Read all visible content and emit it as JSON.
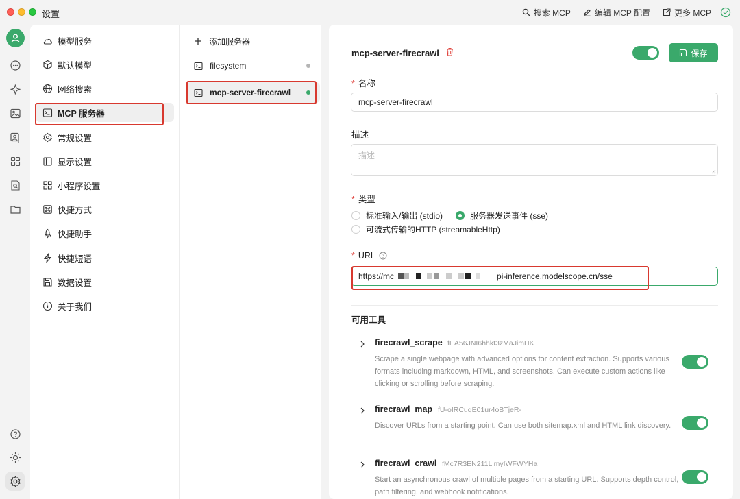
{
  "window": {
    "title": "设置"
  },
  "toolbar": {
    "search_mcp": "搜索 MCP",
    "edit_mcp_config": "编辑 MCP 配置",
    "more_mcp": "更多 MCP"
  },
  "sidebar": {
    "items": [
      {
        "label": "模型服务",
        "icon": "cloud-icon"
      },
      {
        "label": "默认模型",
        "icon": "cube-icon"
      },
      {
        "label": "网络搜索",
        "icon": "globe-icon"
      },
      {
        "label": "MCP 服务器",
        "icon": "terminal-icon"
      },
      {
        "label": "常规设置",
        "icon": "gear-icon"
      },
      {
        "label": "显示设置",
        "icon": "layout-icon"
      },
      {
        "label": "小程序设置",
        "icon": "grid-icon"
      },
      {
        "label": "快捷方式",
        "icon": "command-icon"
      },
      {
        "label": "快捷助手",
        "icon": "rocket-icon"
      },
      {
        "label": "快捷短语",
        "icon": "zap-icon"
      },
      {
        "label": "数据设置",
        "icon": "save-icon"
      },
      {
        "label": "关于我们",
        "icon": "info-icon"
      }
    ]
  },
  "servers": {
    "add_label": "添加服务器",
    "items": [
      {
        "name": "filesystem",
        "status_color": "#b5b5b5"
      },
      {
        "name": "mcp-server-firecrawl",
        "status_color": "#3aa96b"
      }
    ]
  },
  "detail": {
    "title": "mcp-server-firecrawl",
    "save_label": "保存",
    "name_label": "名称",
    "name_value": "mcp-server-firecrawl",
    "desc_label": "描述",
    "desc_placeholder": "描述",
    "type_label": "类型",
    "type_options": [
      "标准输入/输出 (stdio)",
      "服务器发送事件 (sse)",
      "可流式传输的HTTP (streamableHttp)"
    ],
    "type_selected": "服务器发送事件 (sse)",
    "url_label": "URL",
    "url_prefix": "https://mc",
    "url_suffix": "pi-inference.modelscope.cn/sse",
    "tools_title": "可用工具",
    "tools": [
      {
        "name": "firecrawl_scrape",
        "id": "fEA56JNI6hhkt3zMaJimHK",
        "desc": "Scrape a single webpage with advanced options for content extraction. Supports various formats including markdown, HTML, and screenshots. Can execute custom actions like clicking or scrolling before scraping."
      },
      {
        "name": "firecrawl_map",
        "id": "fU-oIRCuqE01ur4oBTjeR-",
        "desc": "Discover URLs from a starting point. Can use both sitemap.xml and HTML link discovery."
      },
      {
        "name": "firecrawl_crawl",
        "id": "fMc7R3EN211LjmyIWFWYHa",
        "desc": "Start an asynchronous crawl of multiple pages from a starting URL. Supports depth control, path filtering, and webhook notifications."
      }
    ]
  },
  "colors": {
    "accent": "#3aa96b",
    "highlight": "#d8392f",
    "required": "#e0443e"
  }
}
